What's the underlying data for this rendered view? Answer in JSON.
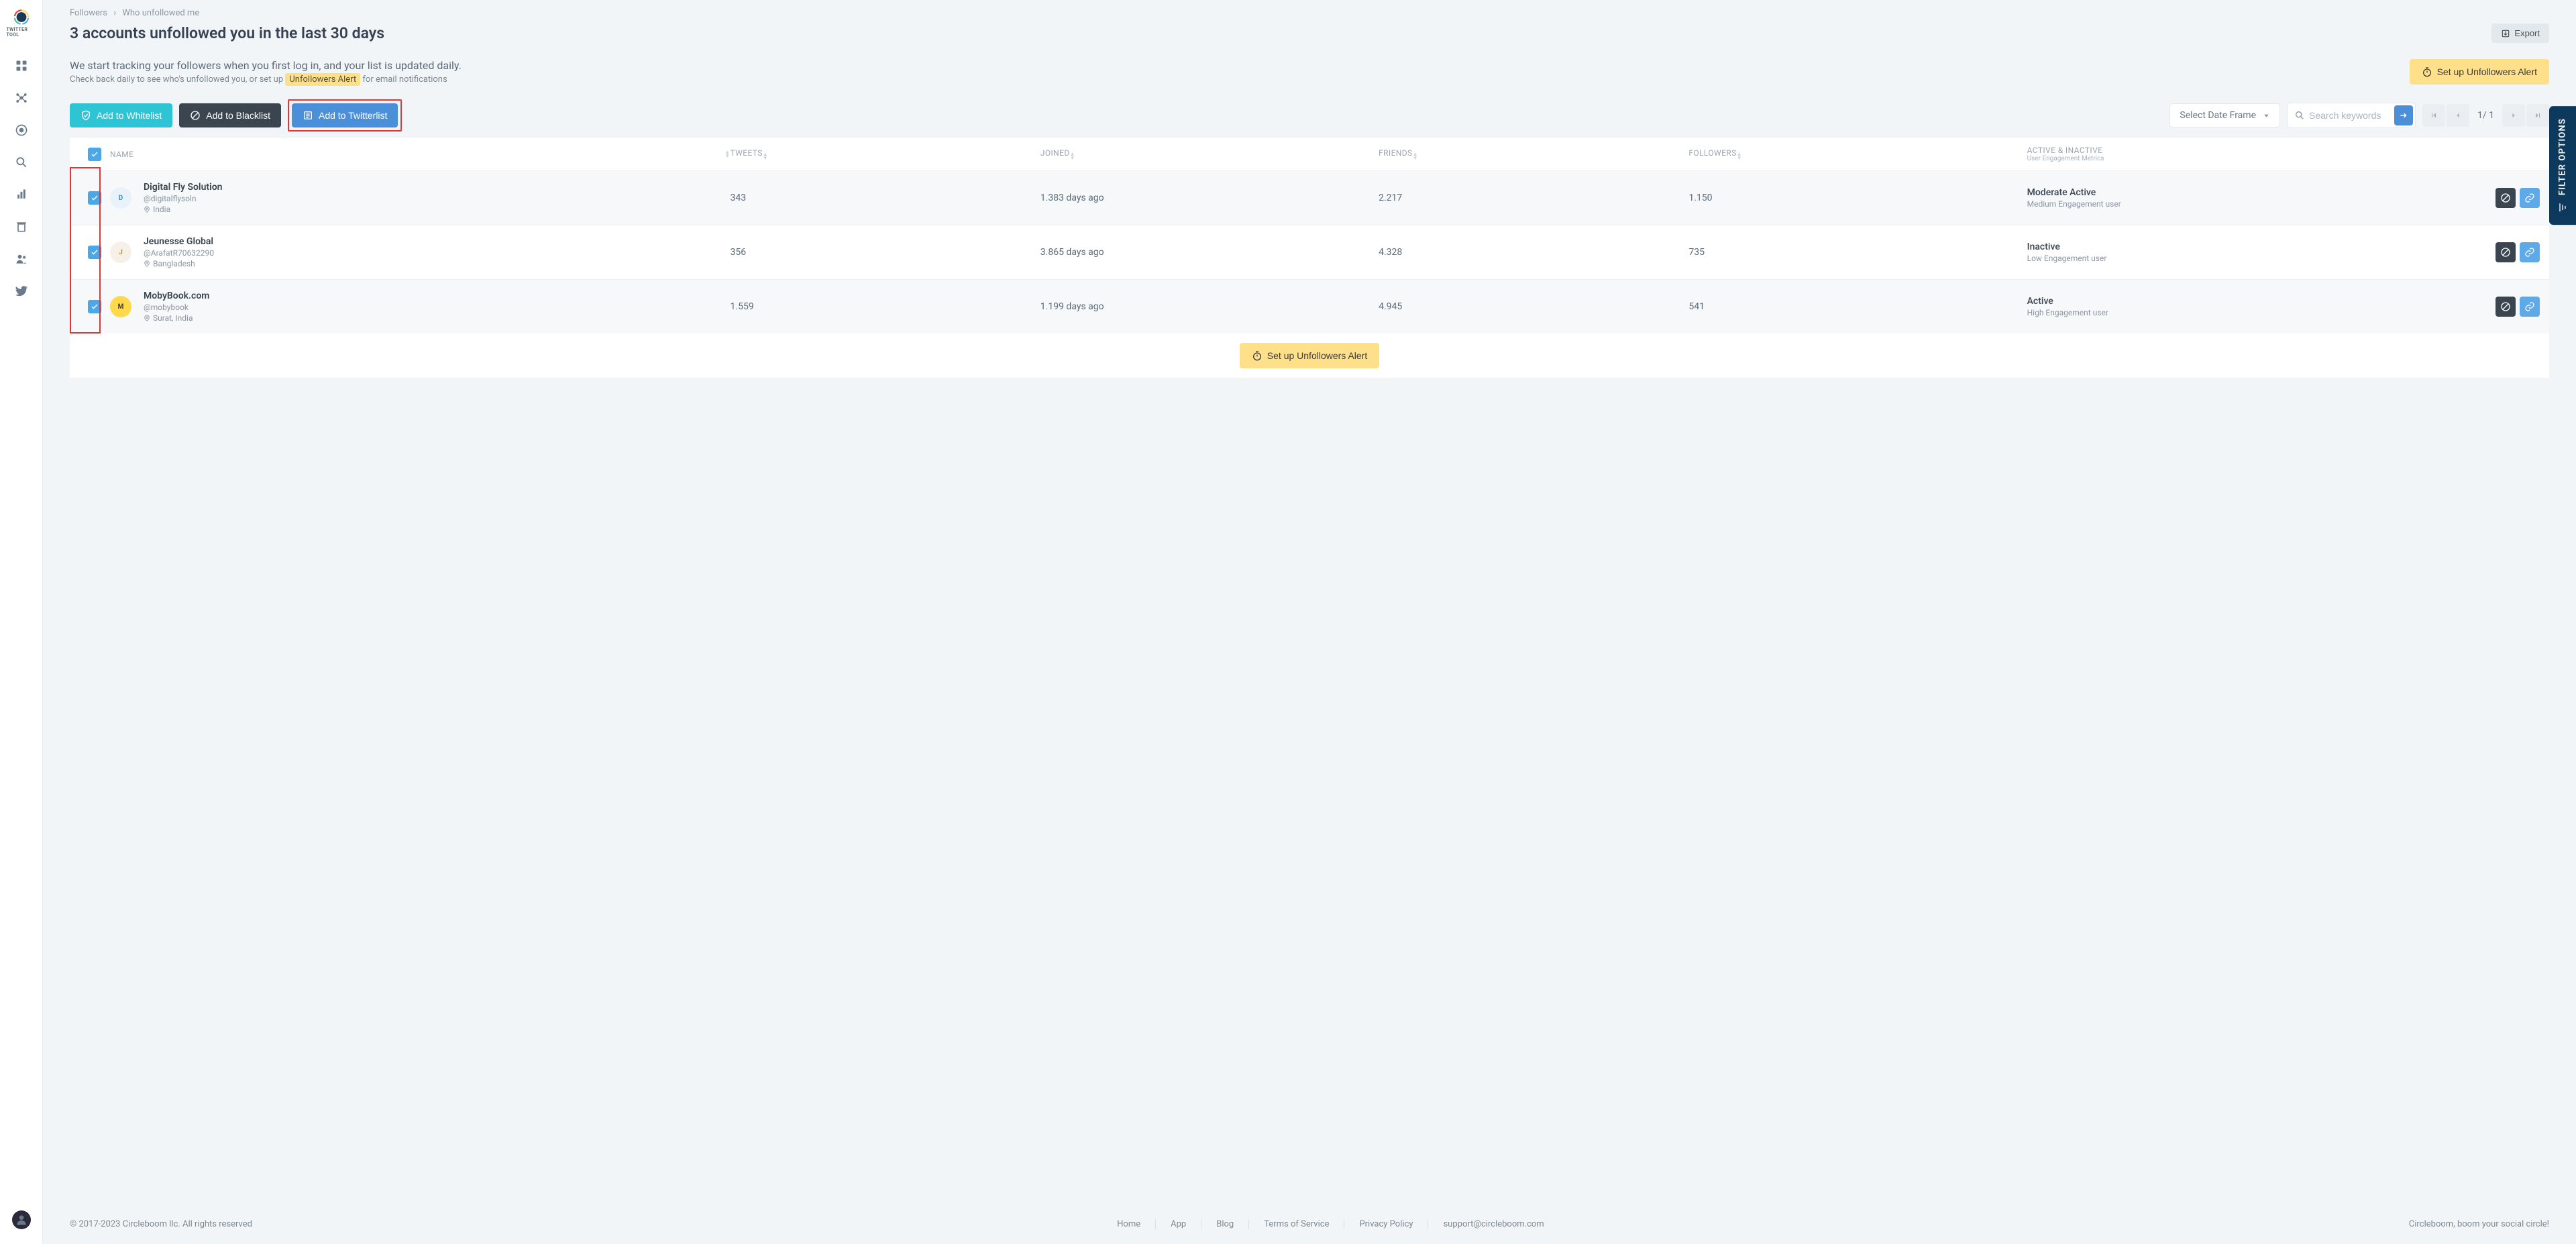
{
  "app_name": "TWITTER TOOL",
  "breadcrumb": {
    "root": "Followers",
    "current": "Who unfollowed me"
  },
  "page_title": "3 accounts unfollowed you in the last 30 days",
  "export_label": "Export",
  "intro": {
    "line1": "We start tracking your followers when you first log in, and your list is updated daily.",
    "line2_pre": "Check back daily to see who's unfollowed you, or set up ",
    "line2_hl": "Unfollowers Alert",
    "line2_post": " for email notifications"
  },
  "alert_button": "Set up Unfollowers Alert",
  "toolbar": {
    "whitelist": "Add to Whitelist",
    "blacklist": "Add to Blacklist",
    "twitterlist": "Add to Twitterlist",
    "date_frame": "Select Date Frame",
    "search_placeholder": "Search keywords"
  },
  "pager": {
    "current": "1",
    "total": "1"
  },
  "columns": {
    "name": "NAME",
    "tweets": "TWEETS",
    "joined": "JOINED",
    "friends": "FRIENDS",
    "followers": "FOLLOWERS",
    "activity": "ACTIVE & INACTIVE",
    "activity_sub": "User Engagement Metrics"
  },
  "rows": [
    {
      "name": "Digital Fly Solution",
      "handle": "@digitalflysoln",
      "location": "India",
      "avatar_letter": "D",
      "avatar_bg": "#e9f2fb",
      "avatar_fg": "#3a8fd8",
      "tweets": "343",
      "joined": "1.383 days ago",
      "friends": "2.217",
      "followers": "1.150",
      "act_title": "Moderate Active",
      "act_sub": "Medium Engagement user"
    },
    {
      "name": "Jeunesse Global",
      "handle": "@ArafatR70632290",
      "location": "Bangladesh",
      "avatar_letter": "J",
      "avatar_bg": "#f6f0e6",
      "avatar_fg": "#c4943d",
      "tweets": "356",
      "joined": "3.865 days ago",
      "friends": "4.328",
      "followers": "735",
      "act_title": "Inactive",
      "act_sub": "Low Engagement user"
    },
    {
      "name": "MobyBook.com",
      "handle": "@mobybook",
      "location": "Surat, India",
      "avatar_letter": "M",
      "avatar_bg": "#ffd94a",
      "avatar_fg": "#3a3a3a",
      "tweets": "1.559",
      "joined": "1.199 days ago",
      "friends": "4.945",
      "followers": "541",
      "act_title": "Active",
      "act_sub": "High Engagement user"
    }
  ],
  "footer": {
    "copyright": "© 2017-2023 Circleboom llc. All rights reserved",
    "links": [
      "Home",
      "App",
      "Blog",
      "Terms of Service",
      "Privacy Policy",
      "support@circleboom.com"
    ],
    "tagline": "Circleboom, boom your social circle!"
  },
  "filter_tab": "FILTER OPTIONS"
}
